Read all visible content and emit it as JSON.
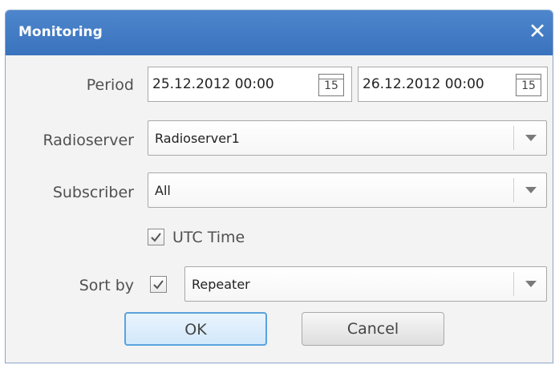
{
  "dialog": {
    "title": "Monitoring",
    "close_label": "✕"
  },
  "period": {
    "label": "Period",
    "from": "25.12.2012 00:00",
    "to": "26.12.2012 00:00",
    "separator": "-",
    "calendar_day": "15"
  },
  "radioserver": {
    "label": "Radioserver",
    "value": "Radioserver1"
  },
  "subscriber": {
    "label": "Subscriber",
    "value": "All"
  },
  "utc_time": {
    "label": "UTC Time",
    "checked": true
  },
  "sort_by": {
    "label": "Sort by",
    "checked": true,
    "value": "Repeater"
  },
  "buttons": {
    "ok": "OK",
    "cancel": "Cancel"
  },
  "colors": {
    "titlebar": "#3f79c3",
    "ok_border": "#5aa2dd"
  }
}
